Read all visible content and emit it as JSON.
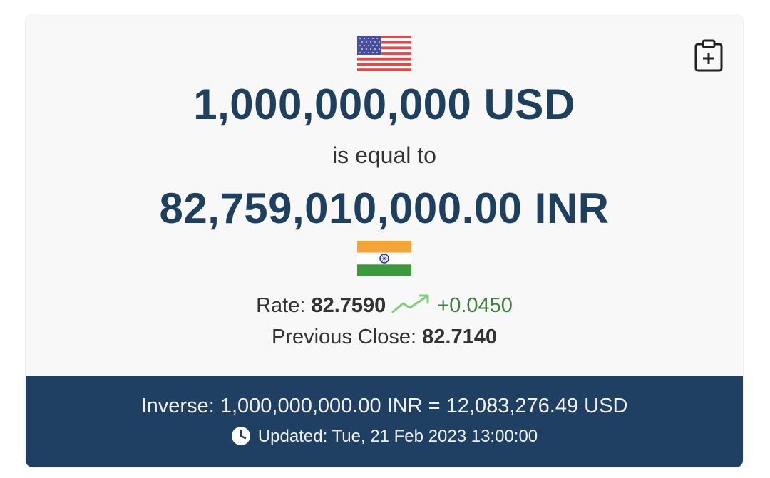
{
  "converter": {
    "from_amount": "1,000,000,000 USD",
    "equal_text": "is equal to",
    "to_amount": "82,759,010,000.00 INR",
    "from_flag": "us-flag-icon",
    "to_flag": "india-flag-icon"
  },
  "rate": {
    "label": "Rate:",
    "value": "82.7590",
    "change": "+0.0450",
    "trend_icon": "trend-up-icon",
    "trend_color": "#7ecf7e"
  },
  "previous_close": {
    "label": "Previous Close:",
    "value": "82.7140"
  },
  "footer": {
    "inverse": "Inverse: 1,000,000,000.00 INR = 12,083,276.49 USD",
    "updated": "Updated: Tue, 21 Feb 2023 13:00:00",
    "clock_icon": "clock-icon"
  },
  "actions": {
    "copy_icon": "clipboard-add-icon"
  },
  "colors": {
    "primary": "#1f3f5f",
    "footer_bg": "#1f4062",
    "change_positive": "#3f7f3f"
  }
}
